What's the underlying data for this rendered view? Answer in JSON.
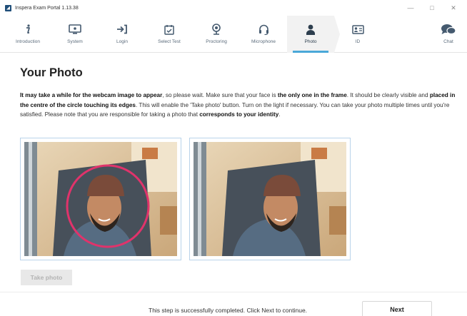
{
  "window": {
    "title": "Inspera Exam Portal 1.13.38",
    "controls": [
      "—",
      "□",
      "✕"
    ]
  },
  "nav": {
    "items": [
      {
        "label": "Introduction",
        "icon": "info-icon"
      },
      {
        "label": "System",
        "icon": "monitor-icon"
      },
      {
        "label": "Login",
        "icon": "sign-in-icon"
      },
      {
        "label": "Select Test",
        "icon": "calendar-check-icon"
      },
      {
        "label": "Proctoring",
        "icon": "webcam-icon"
      },
      {
        "label": "Microphone",
        "icon": "headset-icon"
      },
      {
        "label": "Photo",
        "icon": "user-icon",
        "active": true
      },
      {
        "label": "ID",
        "icon": "id-card-icon"
      }
    ],
    "chat": {
      "label": "Chat",
      "icon": "chat-icon"
    }
  },
  "page": {
    "title": "Your Photo",
    "instructions": {
      "p1": "It may take a while for the webcam image to appear",
      "p2": ", so please wait. Make sure that your face is ",
      "p3": "the only one in the frame",
      "p4": ". It should be clearly visible and ",
      "p5": "placed in the centre of the circle touching its edges",
      "p6": ". This will enable the 'Take photo' button. Turn on the light if necessary. You can take your photo multiple times until you're satisfied. Please note that you are responsible for taking a photo that ",
      "p7": "corresponds to your identity",
      "p8": "."
    },
    "take_photo_label": "Take photo"
  },
  "footer": {
    "message": "This step is successfully completed. Click Next to continue.",
    "next_label": "Next"
  },
  "colors": {
    "accent": "#4aa8d8",
    "circle": "#e0336b",
    "frame_border": "#b9d3ea"
  }
}
